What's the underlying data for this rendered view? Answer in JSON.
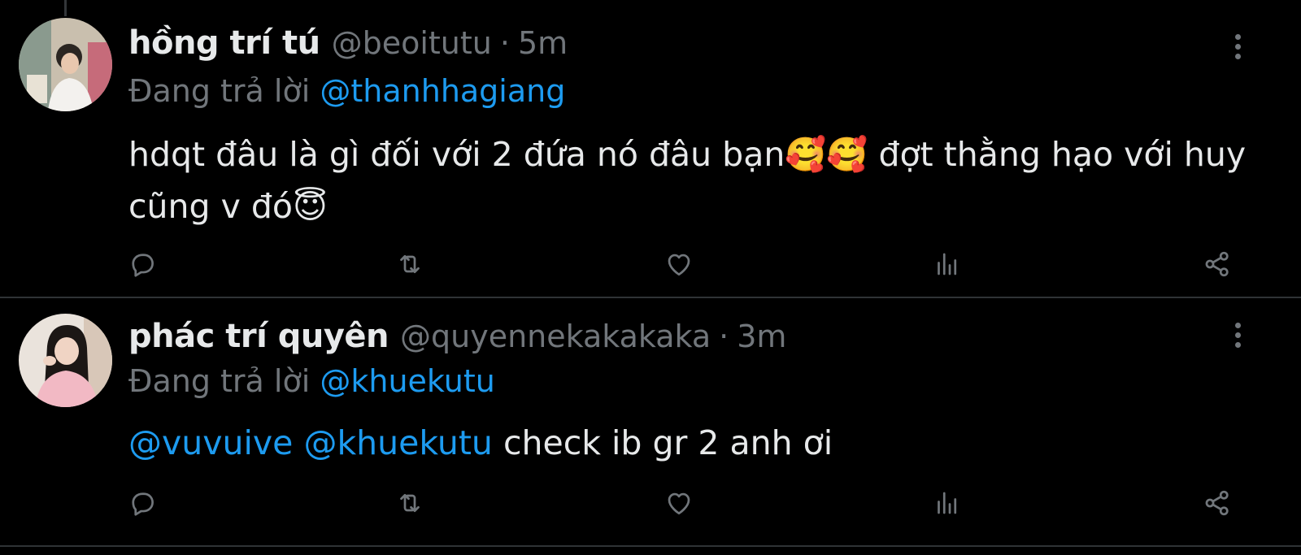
{
  "tweets": [
    {
      "display_name": "hồng trí tú",
      "handle": "@beoitutu",
      "separator": "·",
      "time": "5m",
      "reply_label": "Đang trả lời",
      "reply_to": "@thanhhagiang",
      "text_line1": "hdqt đâu là gì đối với 2 đứa nó đâu bạn🥰🥰 đợt thằng hạo với huy",
      "text_line2": "cũng v đó😇"
    },
    {
      "display_name": "phác trí quyên",
      "handle": "@quyennekakakaka",
      "separator": "·",
      "time": "3m",
      "reply_label": "Đang trả lời",
      "reply_to": "@khuekutu",
      "mention1": "@vuvuive",
      "mention2": "@khuekutu",
      "text_rest": "check ib gr 2 anh ơi"
    }
  ],
  "icons": {
    "reply": "reply-icon",
    "retweet": "retweet-icon",
    "like": "heart-icon",
    "views": "views-icon",
    "share": "share-icon",
    "more": "more-vertical-icon"
  },
  "colors": {
    "background": "#000000",
    "text": "#e7e9ea",
    "secondary": "#71767b",
    "accent": "#1d9bf0",
    "divider": "#2f3336"
  }
}
